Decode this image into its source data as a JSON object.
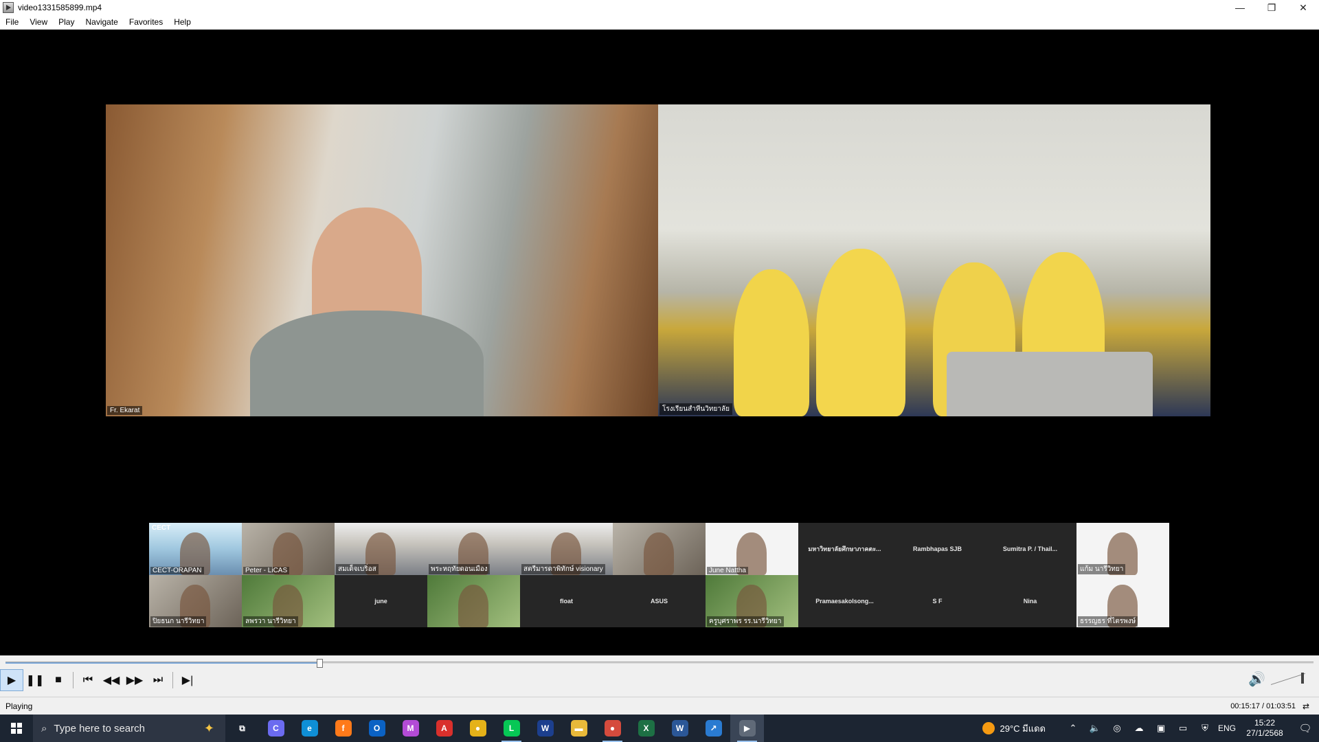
{
  "window": {
    "title": "video1331585899.mp4",
    "minimize": "—",
    "restore": "❐",
    "close": "✕"
  },
  "menu": [
    "File",
    "View",
    "Play",
    "Navigate",
    "Favorites",
    "Help"
  ],
  "video": {
    "speakers": [
      {
        "name": "Fr. Ekarat"
      },
      {
        "name": "โรงเรียนสำหีนวิทยาลัย"
      }
    ],
    "gallery": [
      {
        "label": "CECT-ORAPAN",
        "style": "sky",
        "badge": "CECT",
        "mode": "bottom"
      },
      {
        "label": "Peter - LiCAS",
        "style": "photo",
        "mode": "bottom"
      },
      {
        "label": "สมเด็จเบริ่อส",
        "style": "room",
        "mode": "bottom"
      },
      {
        "label": "พระหฤทัยดอนเมือง",
        "style": "room",
        "mode": "bottom"
      },
      {
        "label": "สตรีมารดาพิทักษ์ visionary",
        "style": "room",
        "mode": "bottom"
      },
      {
        "label": "",
        "style": "photo",
        "mode": "bottom"
      },
      {
        "label": "June Nattha",
        "style": "white",
        "mode": "bottom"
      },
      {
        "label": "มหาวิทยาลัยศึกษาภาคตะ...",
        "style": "dark",
        "mode": "center"
      },
      {
        "label": "Rambhapas SJB",
        "style": "dark",
        "mode": "center"
      },
      {
        "label": "Sumitra P. / Thail...",
        "style": "dark",
        "mode": "center"
      },
      {
        "label": "แก้ม นารีวิทยา",
        "style": "white",
        "mode": "bottom"
      },
      {
        "label": "ปิยธนก นารีวิทยา",
        "style": "photo",
        "mode": "bottom"
      },
      {
        "label": "ลพรวา นารีวิทยา",
        "style": "green",
        "mode": "bottom"
      },
      {
        "label": "june",
        "style": "dark",
        "mode": "center"
      },
      {
        "label": "",
        "style": "green",
        "mode": "bottom"
      },
      {
        "label": "float",
        "style": "dark",
        "mode": "center"
      },
      {
        "label": "ASUS",
        "style": "dark",
        "mode": "center"
      },
      {
        "label": "ครูบุศราพร รร.นารีวิทยา",
        "style": "green",
        "mode": "bottom"
      },
      {
        "label": "Pramaesakolsong...",
        "style": "dark",
        "mode": "center"
      },
      {
        "label": "S F",
        "style": "dark",
        "mode": "center"
      },
      {
        "label": "Nina",
        "style": "dark",
        "mode": "center"
      },
      {
        "label": "ธรรญธร ที่ไตรพงษ์",
        "style": "white",
        "mode": "bottom"
      }
    ]
  },
  "player": {
    "progress_fraction": 0.24,
    "status": "Playing",
    "time": "00:15:17 / 01:03:51",
    "buttons": [
      "▶",
      "❚❚",
      "■",
      "⏮",
      "◀◀",
      "▶▶",
      "⏭",
      "▶|"
    ],
    "volume_icon": "🔊",
    "split_icon": "⇄"
  },
  "taskbar": {
    "search_placeholder": "Type here to search",
    "apps": [
      {
        "name": "task-view",
        "glyph": "⧉",
        "color": "transparent"
      },
      {
        "name": "copilot",
        "glyph": "C",
        "color": "#6b6bf0"
      },
      {
        "name": "edge",
        "glyph": "e",
        "color": "#0f8fd6"
      },
      {
        "name": "firefox",
        "glyph": "f",
        "color": "#ff7a1a"
      },
      {
        "name": "outlook",
        "glyph": "O",
        "color": "#0b62c4"
      },
      {
        "name": "m365",
        "glyph": "M",
        "color": "#b34bd6"
      },
      {
        "name": "acrobat",
        "glyph": "A",
        "color": "#d9302c"
      },
      {
        "name": "chrome",
        "glyph": "●",
        "color": "#e5b219"
      },
      {
        "name": "line",
        "glyph": "L",
        "color": "#06c755"
      },
      {
        "name": "webex",
        "glyph": "W",
        "color": "#1c3f8e"
      },
      {
        "name": "explorer",
        "glyph": "▬",
        "color": "#e8b93a"
      },
      {
        "name": "chrome-2",
        "glyph": "●",
        "color": "#d54b3d"
      },
      {
        "name": "excel",
        "glyph": "X",
        "color": "#1d7044"
      },
      {
        "name": "word",
        "glyph": "W",
        "color": "#2b5797"
      },
      {
        "name": "remote",
        "glyph": "↗",
        "color": "#2a7bd1"
      },
      {
        "name": "mpc",
        "glyph": "▶",
        "color": "#606a78"
      }
    ],
    "weather": "29°C มีแดด",
    "lang": "ENG",
    "clock_time": "15:22",
    "clock_date": "27/1/2568"
  }
}
